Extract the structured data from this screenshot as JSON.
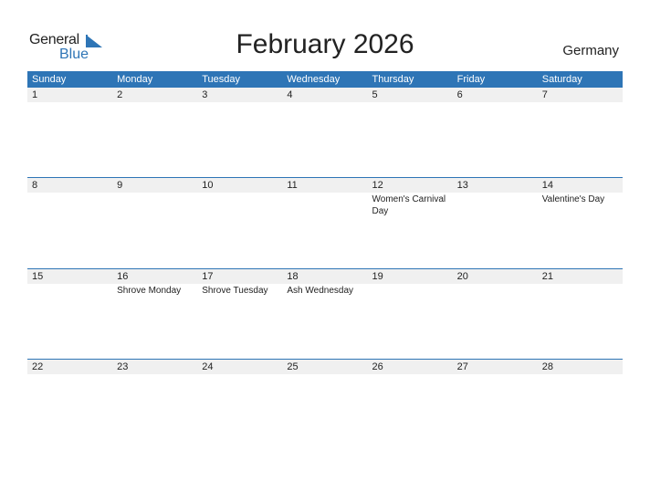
{
  "logo": {
    "general": "General",
    "blue": "Blue",
    "accent": "#2e75b6"
  },
  "title": "February 2026",
  "country": "Germany",
  "weekdays": [
    "Sunday",
    "Monday",
    "Tuesday",
    "Wednesday",
    "Thursday",
    "Friday",
    "Saturday"
  ],
  "weeks": [
    {
      "days": [
        {
          "num": "1",
          "holiday": ""
        },
        {
          "num": "2",
          "holiday": ""
        },
        {
          "num": "3",
          "holiday": ""
        },
        {
          "num": "4",
          "holiday": ""
        },
        {
          "num": "5",
          "holiday": ""
        },
        {
          "num": "6",
          "holiday": ""
        },
        {
          "num": "7",
          "holiday": ""
        }
      ]
    },
    {
      "days": [
        {
          "num": "8",
          "holiday": ""
        },
        {
          "num": "9",
          "holiday": ""
        },
        {
          "num": "10",
          "holiday": ""
        },
        {
          "num": "11",
          "holiday": ""
        },
        {
          "num": "12",
          "holiday": "Women's Carnival Day"
        },
        {
          "num": "13",
          "holiday": ""
        },
        {
          "num": "14",
          "holiday": "Valentine's Day"
        }
      ]
    },
    {
      "days": [
        {
          "num": "15",
          "holiday": ""
        },
        {
          "num": "16",
          "holiday": "Shrove Monday"
        },
        {
          "num": "17",
          "holiday": "Shrove Tuesday"
        },
        {
          "num": "18",
          "holiday": "Ash Wednesday"
        },
        {
          "num": "19",
          "holiday": ""
        },
        {
          "num": "20",
          "holiday": ""
        },
        {
          "num": "21",
          "holiday": ""
        }
      ]
    },
    {
      "days": [
        {
          "num": "22",
          "holiday": ""
        },
        {
          "num": "23",
          "holiday": ""
        },
        {
          "num": "24",
          "holiday": ""
        },
        {
          "num": "25",
          "holiday": ""
        },
        {
          "num": "26",
          "holiday": ""
        },
        {
          "num": "27",
          "holiday": ""
        },
        {
          "num": "28",
          "holiday": ""
        }
      ]
    }
  ]
}
